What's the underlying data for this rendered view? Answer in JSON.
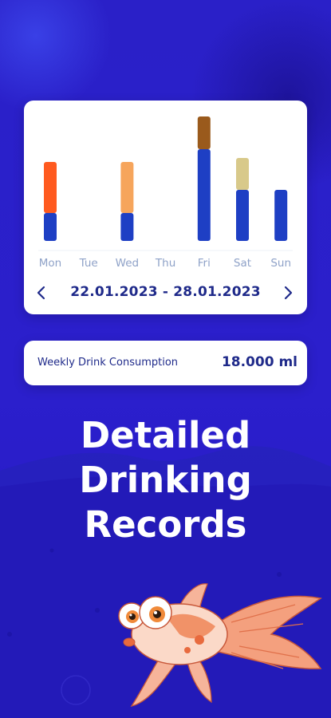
{
  "colors": {
    "background": "#2b1fc9",
    "card": "#ffffff",
    "text_dark": "#1f2a8a",
    "label_muted": "#8fa2c8",
    "bar_water": "#1e3fc4",
    "bar_coffee": "#ff5a1f",
    "bar_juice": "#f6a55c",
    "bar_tea": "#9a5a1c",
    "bar_beer": "#d8c98a"
  },
  "chart_data": {
    "type": "bar",
    "stacked": true,
    "categories": [
      "Mon",
      "Tue",
      "Wed",
      "Thu",
      "Fri",
      "Sat",
      "Sun"
    ],
    "series": [
      {
        "color": "#1e3fc4",
        "values": [
          35,
          0,
          35,
          0,
          115,
          64,
          64
        ]
      },
      {
        "color": "#ff5a1f",
        "values": [
          64,
          0,
          0,
          0,
          0,
          0,
          0
        ]
      },
      {
        "color": "#f6a55c",
        "values": [
          0,
          0,
          64,
          0,
          0,
          0,
          0
        ]
      },
      {
        "color": "#9a5a1c",
        "values": [
          0,
          0,
          0,
          0,
          41,
          0,
          0
        ]
      },
      {
        "color": "#d8c98a",
        "values": [
          0,
          0,
          0,
          0,
          0,
          40,
          0
        ]
      }
    ],
    "ylim": [
      0,
      160
    ],
    "grid": false,
    "legend": "none"
  },
  "week": {
    "range": "22.01.2023 - 28.01.2023",
    "prev_icon": "chevron-left-icon",
    "next_icon": "chevron-right-icon"
  },
  "summary": {
    "label": "Weekly Drink Consumption",
    "value": "18.000 ml"
  },
  "headline": {
    "line1": "Detailed",
    "line2": "Drinking",
    "line3": "Records"
  },
  "mascot": {
    "icon": "goldfish-illustration"
  }
}
